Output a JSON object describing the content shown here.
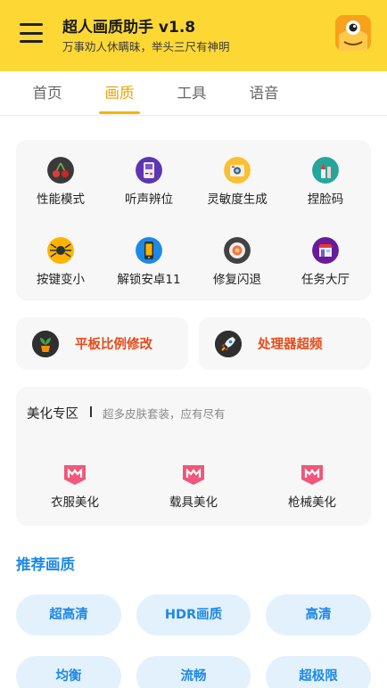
{
  "header": {
    "title": "超人画质助手 v1.8",
    "subtitle": "万事劝人休瞒昧，举头三尺有神明",
    "menu_icon": "menu-icon",
    "logo_icon": "app-logo-icon",
    "background_color": "#FDD835"
  },
  "tabs": [
    {
      "label": "首页",
      "active": false
    },
    {
      "label": "画质",
      "active": true
    },
    {
      "label": "工具",
      "active": false
    },
    {
      "label": "语音",
      "active": false
    }
  ],
  "functions": [
    {
      "label": "性能模式",
      "icon": "cherry-icon"
    },
    {
      "label": "听声辨位",
      "icon": "gameboy-icon"
    },
    {
      "label": "灵敏度生成",
      "icon": "camera-icon"
    },
    {
      "label": "捏脸码",
      "icon": "lipstick-icon"
    },
    {
      "label": "按键变小",
      "icon": "spider-icon"
    },
    {
      "label": "解锁安卓11",
      "icon": "phone-icon"
    },
    {
      "label": "修复闪退",
      "icon": "sushi-icon"
    },
    {
      "label": "任务大厅",
      "icon": "store-icon"
    }
  ],
  "actions": [
    {
      "label": "平板比例修改",
      "icon": "plant-icon"
    },
    {
      "label": "处理器超频",
      "icon": "rocket-icon"
    }
  ],
  "beauty": {
    "title": "美化专区",
    "subtitle": "超多皮肤套装，应有尽有",
    "items": [
      {
        "label": "衣服美化",
        "icon": "m-badge-icon"
      },
      {
        "label": "载具美化",
        "icon": "m-badge-icon"
      },
      {
        "label": "枪械美化",
        "icon": "m-badge-icon"
      }
    ]
  },
  "recommended": {
    "title": "推荐画质",
    "options": [
      "超高清",
      "HDR画质",
      "高清",
      "均衡",
      "流畅",
      "超极限"
    ]
  },
  "colors": {
    "accent_yellow": "#F5B400",
    "action_text": "#E64A19",
    "blue": "#1E88E5",
    "pill_bg": "#E3F1FC"
  }
}
